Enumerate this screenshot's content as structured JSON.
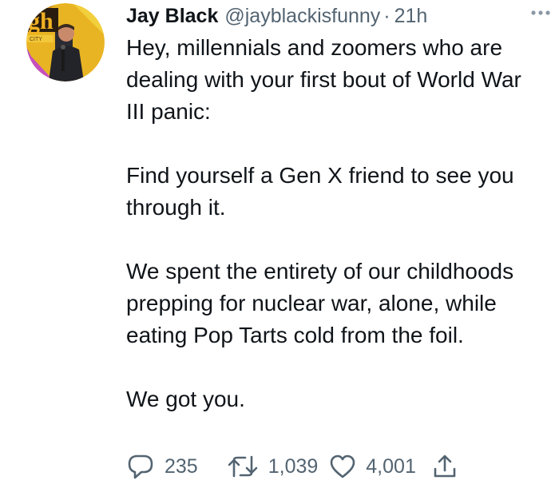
{
  "author": {
    "name": "Jay Black",
    "handle": "@jayblackisfunny",
    "separator": "·",
    "time": "21h",
    "avatar_icon": "comedy-stage-portrait"
  },
  "tweet": {
    "paragraphs": [
      "Hey, millennials and zoomers who are dealing with your first bout of World War III panic:",
      "Find yourself a Gen X friend to see you through it.",
      "We spent the entirety of our childhoods prepping for nuclear war, alone, while eating Pop Tarts cold from the foil.",
      "We got you."
    ]
  },
  "actions": {
    "reply_count": "235",
    "retweet_count": "1,039",
    "like_count": "4,001",
    "reply_icon": "reply-icon",
    "retweet_icon": "retweet-icon",
    "like_icon": "heart-icon",
    "share_icon": "share-icon"
  },
  "colors": {
    "text_primary": "#0f1419",
    "text_secondary": "#536471",
    "more_dots": "#8b98a5"
  }
}
